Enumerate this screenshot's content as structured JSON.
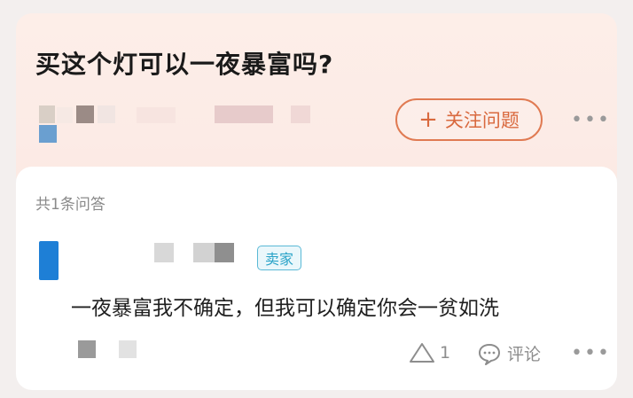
{
  "question": {
    "title": "买这个灯可以一夜暴富吗?",
    "follow_label": "关注问题",
    "follow_icon": "plus-icon"
  },
  "answers": {
    "count_label": "共1条问答",
    "items": [
      {
        "badge": "卖家",
        "text": "一夜暴富我不确定，但我可以确定你会一贫如洗",
        "like_count": "1",
        "comment_label": "评论"
      }
    ]
  },
  "colors": {
    "accent": "#d9693e",
    "badge": "#2aa3c8",
    "avatar": "#1e7fd6"
  }
}
